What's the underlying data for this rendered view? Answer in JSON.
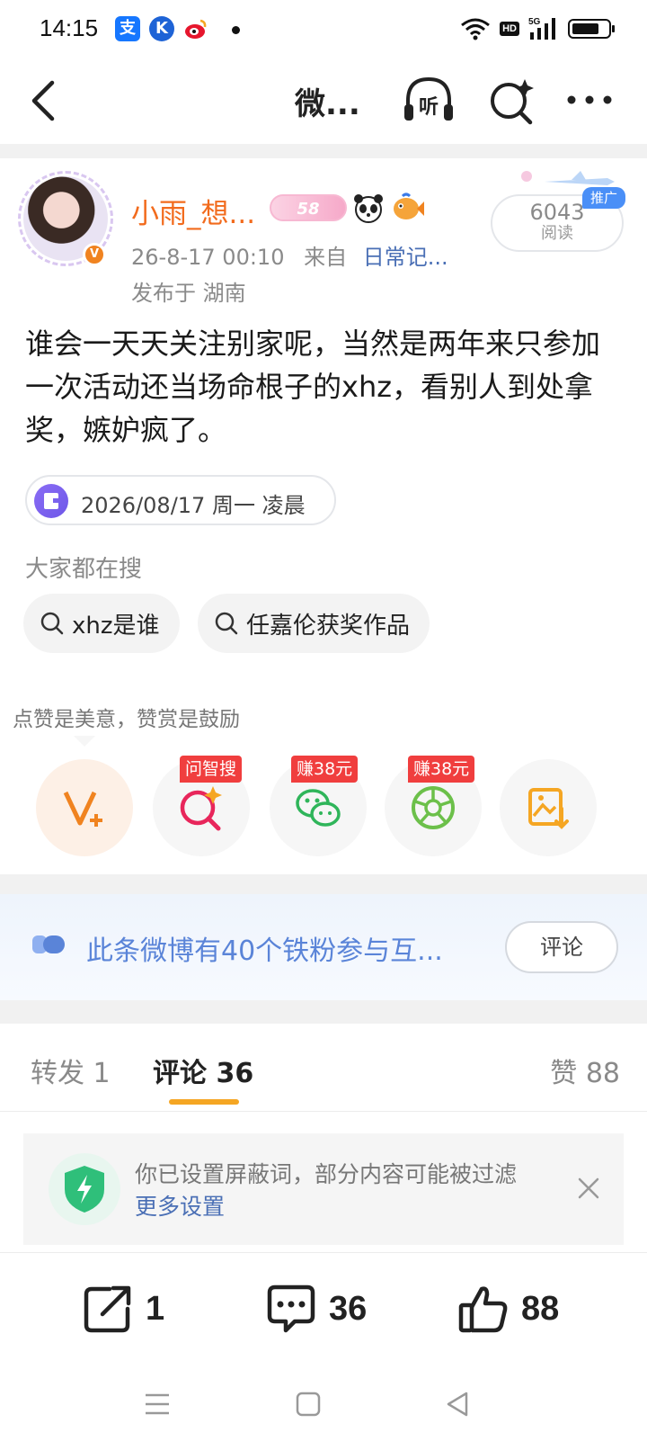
{
  "status_bar": {
    "time": "14:15",
    "apps": [
      "alipay-icon",
      "k-app-icon",
      "weibo-icon"
    ],
    "hd": "HD",
    "network": "5G",
    "battery_level": 0.78
  },
  "nav": {
    "title": "微...",
    "listen_label": "听"
  },
  "post": {
    "username": "小雨_想...",
    "level": "58",
    "meta_time": "26-8-17 00:10",
    "meta_from": "来自",
    "meta_source": "日常记...",
    "location": "发布于 湖南",
    "read_count": "6043",
    "read_label": "阅读",
    "promo_tag": "推广",
    "body": "谁会一天天关注别家呢，当然是两年来只参加一次活动还当场命根子的xhz，看别人到处拿奖，嫉妒疯了。",
    "date_chip": "2026/08/17 周一 凌晨"
  },
  "hot_search": {
    "title": "大家都在搜",
    "items": [
      "xhz是谁",
      "任嘉伦获奖作品"
    ]
  },
  "reward": {
    "tip": "点赞是美意，赞赏是鼓励",
    "actions": [
      {
        "icon": "reward-v-plus-icon",
        "tag": ""
      },
      {
        "icon": "zhisou-search-icon",
        "tag": "问智搜"
      },
      {
        "icon": "wechat-icon",
        "tag": "赚38元"
      },
      {
        "icon": "moments-icon",
        "tag": "赚38元"
      },
      {
        "icon": "save-image-icon",
        "tag": ""
      }
    ]
  },
  "fans_banner": {
    "text": "此条微博有40个铁粉参与互...",
    "button": "评论"
  },
  "tabs": {
    "repost": "转发 1",
    "comments": "评论 36",
    "likes": "赞 88"
  },
  "notice": {
    "text": "你已设置屏蔽词，部分内容可能被过滤",
    "link": "更多设置"
  },
  "bottom_bar": {
    "repost_count": "1",
    "comment_count": "36",
    "like_count": "88"
  },
  "colors": {
    "username": "#f26b1d",
    "link": "#4a6fb5",
    "tab_underline": "#f5a623",
    "tag_red": "#f03e3e"
  }
}
